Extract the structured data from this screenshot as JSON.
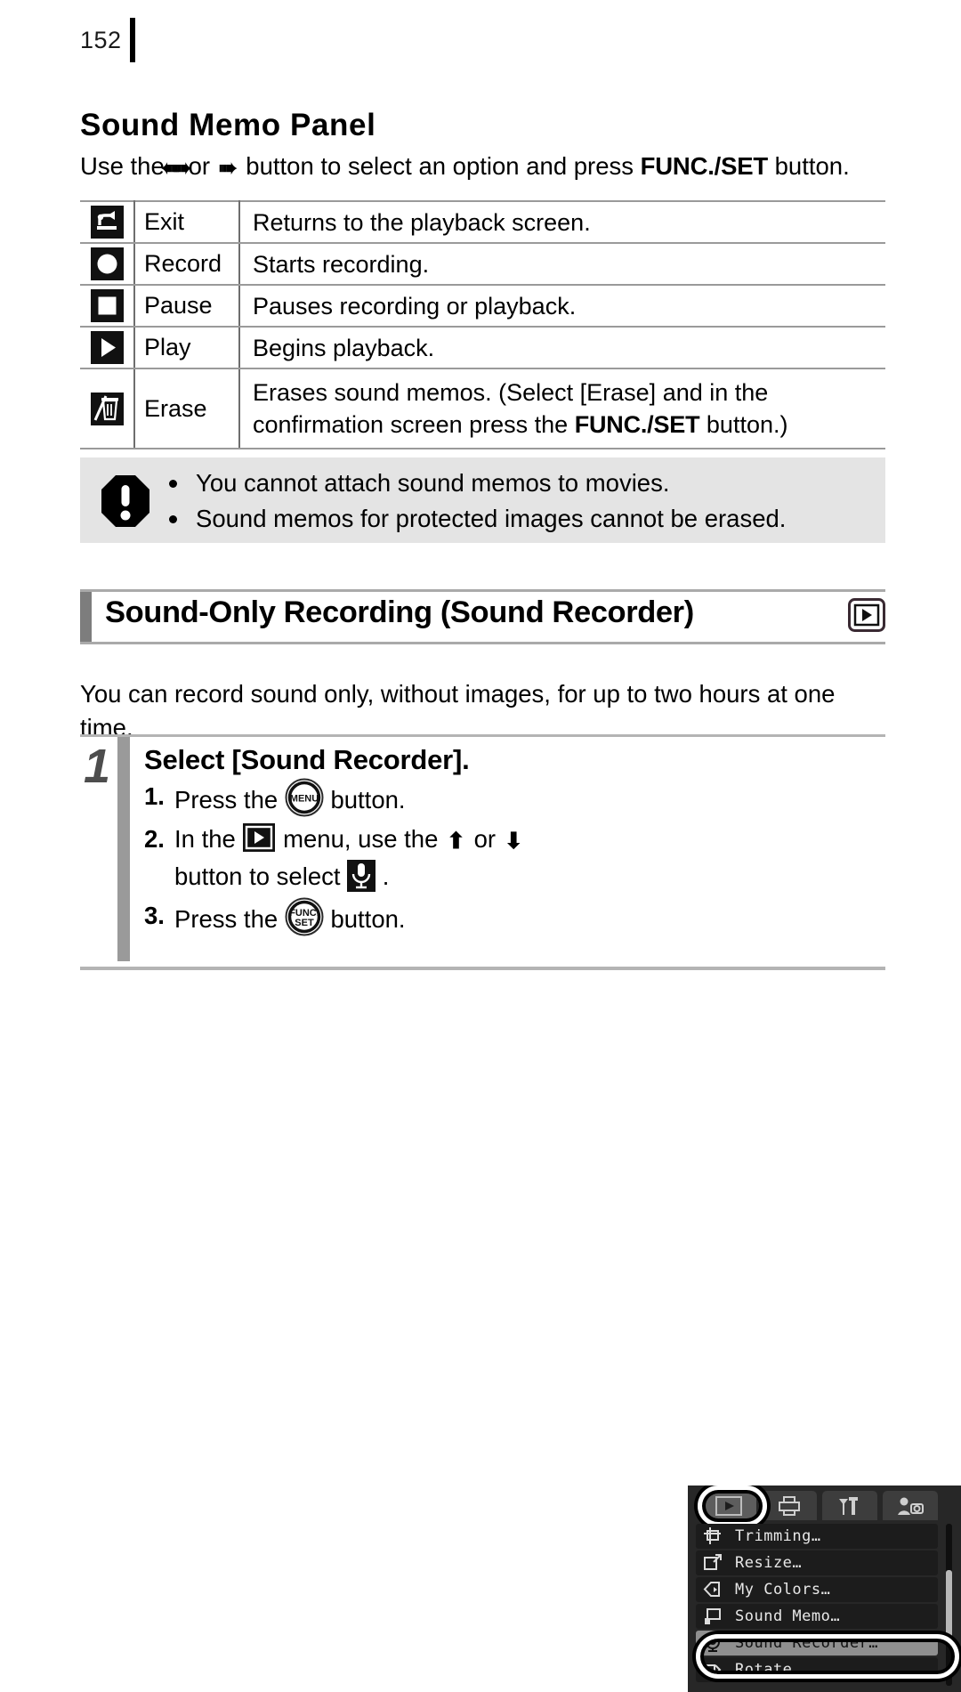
{
  "page": {
    "number": "152"
  },
  "sound_memo": {
    "title": "Sound Memo Panel",
    "intro_before": "Use the",
    "intro_arrow_left": "←",
    "intro_or": "or",
    "intro_arrow_right": "→",
    "intro_middle": "button to select an option and press",
    "intro_bold": "FUNC./SET",
    "intro_after": "button.",
    "table": {
      "rows": [
        {
          "icon": "exit-return-icon",
          "name": "Exit",
          "desc": "Returns to the playback screen."
        },
        {
          "icon": "record-circle-icon",
          "name": "Record",
          "desc": "Starts recording."
        },
        {
          "icon": "pause-square-icon",
          "name": "Pause",
          "desc": "Pauses recording or playback."
        },
        {
          "icon": "play-triangle-icon",
          "name": "Play",
          "desc": "Begins playback."
        },
        {
          "icon": "erase-trash-icon",
          "name": "Erase",
          "desc_line1": "Erases sound memos. (Select [Erase] and in the",
          "desc_line2_before": "confirmation screen press the",
          "desc_line2_bold": "FUNC./SET",
          "desc_line2_after": "button.)"
        }
      ]
    }
  },
  "note_box": {
    "icon": "caution-exclamation-icon",
    "items": [
      "You cannot attach sound memos to movies.",
      "Sound memos for protected images cannot be erased."
    ]
  },
  "sound_recorder": {
    "heading": "Sound-Only Recording (Sound Recorder)",
    "heading_badge_icon": "playback-mode-icon",
    "body": "You can record sound only, without images, for up to two hours at one time.",
    "step": {
      "number": "1",
      "title": "Select [Sound Recorder].",
      "substeps": [
        {
          "num": "1.",
          "before": "Press the",
          "button_icon": "menu-button-icon",
          "button_label": "MENU",
          "after": "button."
        },
        {
          "num": "2.",
          "before": "In the",
          "menu_icon": "playback-menu-icon",
          "middle": "menu, use the",
          "arrow_up": "↑",
          "or": "or",
          "arrow_down": "↓",
          "after_line": "button to select",
          "target_icon": "microphone-icon",
          "period": "."
        },
        {
          "num": "3.",
          "before": "Press the",
          "button_icon": "func-set-button-icon",
          "button_label_top": "FUNC.",
          "button_label_bottom": "SET",
          "after": "button."
        }
      ]
    },
    "lcd": {
      "tabs": [
        {
          "name": "playback-tab",
          "icon": "play-icon",
          "active": true
        },
        {
          "name": "print-tab",
          "icon": "printer-icon",
          "active": false
        },
        {
          "name": "settings-tab",
          "icon": "wrench-hammer-icon",
          "active": false
        },
        {
          "name": "my-camera-tab",
          "icon": "my-camera-icon",
          "active": false
        }
      ],
      "items": [
        {
          "label": "Trimming…",
          "icon": "trimming-icon",
          "selected": false
        },
        {
          "label": "Resize…",
          "icon": "resize-icon",
          "selected": false
        },
        {
          "label": "My Colors…",
          "icon": "my-colors-icon",
          "selected": false
        },
        {
          "label": "Sound Memo…",
          "icon": "sound-memo-icon",
          "selected": false
        },
        {
          "label": "Sound Recorder…",
          "icon": "microphone-icon",
          "selected": true
        },
        {
          "label": "Rotate…",
          "icon": "rotate-icon",
          "selected": false
        }
      ]
    }
  },
  "colors": {
    "page_bg": "#ffffff",
    "text": "#000000",
    "note_bg": "#e4e4e4",
    "rule_gray": "#9a9a9a",
    "step_bar": "#9a9a9a",
    "heading_bar": "#7d7d7d",
    "lcd_bg": "#272727",
    "lcd_selected": "#8f8f8f"
  }
}
